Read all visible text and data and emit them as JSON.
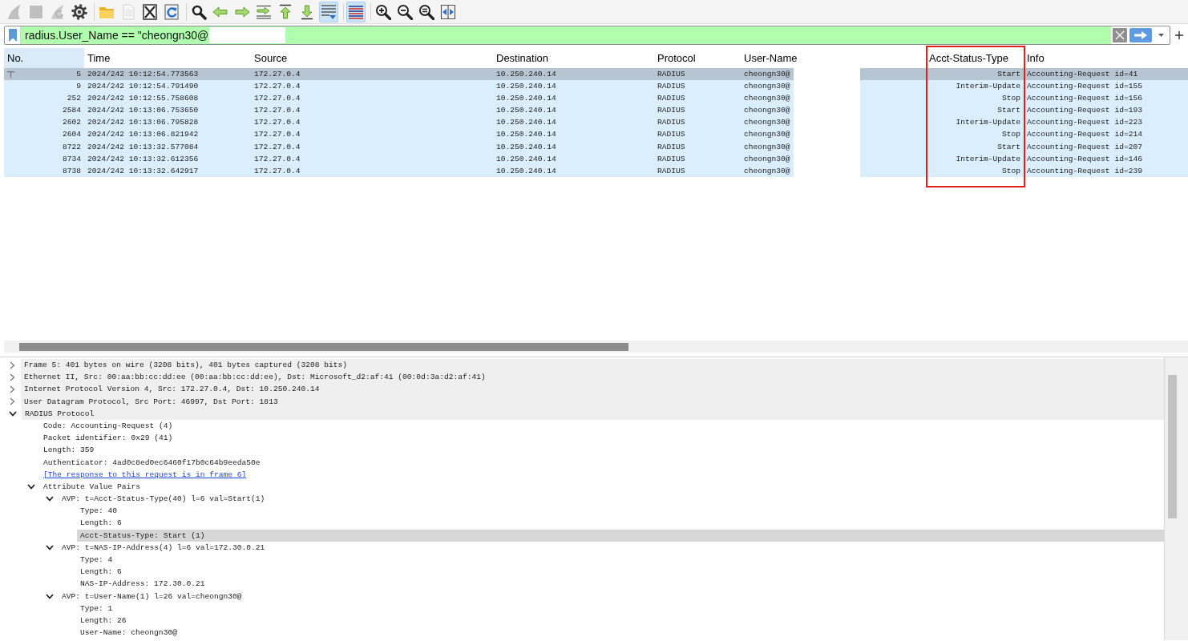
{
  "toolbar": {
    "groups": [
      [
        {
          "kind": "fin",
          "disabled": true,
          "pressed": false
        },
        {
          "kind": "stop",
          "disabled": true,
          "pressed": false
        },
        {
          "kind": "restart",
          "disabled": true,
          "pressed": false
        },
        {
          "kind": "options",
          "disabled": false,
          "pressed": false
        }
      ],
      [
        {
          "kind": "open",
          "disabled": false,
          "pressed": false
        },
        {
          "kind": "save",
          "disabled": true,
          "pressed": false
        },
        {
          "kind": "close",
          "disabled": false,
          "pressed": false
        },
        {
          "kind": "reload",
          "disabled": false,
          "pressed": false
        }
      ],
      [
        {
          "kind": "find",
          "disabled": false,
          "pressed": false
        },
        {
          "kind": "back",
          "disabled": false,
          "pressed": false
        },
        {
          "kind": "forward",
          "disabled": false,
          "pressed": false
        },
        {
          "kind": "goto",
          "disabled": false,
          "pressed": false
        },
        {
          "kind": "first",
          "disabled": false,
          "pressed": false
        },
        {
          "kind": "last",
          "disabled": false,
          "pressed": false
        },
        {
          "kind": "autoscroll",
          "disabled": false,
          "pressed": true
        }
      ],
      [
        {
          "kind": "colorize",
          "disabled": false,
          "pressed": true
        }
      ],
      [
        {
          "kind": "zoomin",
          "disabled": false,
          "pressed": false
        },
        {
          "kind": "zoomout",
          "disabled": false,
          "pressed": false
        },
        {
          "kind": "zoomreset",
          "disabled": false,
          "pressed": false
        },
        {
          "kind": "resize",
          "disabled": false,
          "pressed": false
        }
      ]
    ]
  },
  "filter": {
    "value": "radius.User_Name == \"cheongn30@",
    "valid": true,
    "redacted": true
  },
  "packet_list": {
    "columns": [
      {
        "title": "No.",
        "sorted": true,
        "highlighted": false,
        "redacted": false
      },
      {
        "title": "Time",
        "sorted": false,
        "highlighted": false,
        "redacted": false
      },
      {
        "title": "Source",
        "sorted": false,
        "highlighted": false,
        "redacted": false
      },
      {
        "title": "Destination",
        "sorted": false,
        "highlighted": false,
        "redacted": false
      },
      {
        "title": "Protocol",
        "sorted": false,
        "highlighted": false,
        "redacted": false
      },
      {
        "title": "User-Name",
        "sorted": false,
        "highlighted": false,
        "redacted": true
      },
      {
        "title": "Acct-Status-Type",
        "sorted": false,
        "highlighted": true,
        "redacted": false
      },
      {
        "title": "Info",
        "sorted": false,
        "highlighted": false,
        "redacted": false
      }
    ],
    "rows": [
      {
        "selected": true,
        "cells": [
          "5",
          "2024/242 10:12:54.773563",
          "172.27.0.4",
          "10.250.240.14",
          "RADIUS",
          "cheongn30@",
          "Start",
          "Accounting-Request id=41"
        ]
      },
      {
        "selected": false,
        "cells": [
          "9",
          "2024/242 10:12:54.791490",
          "172.27.0.4",
          "10.250.240.14",
          "RADIUS",
          "cheongn30@",
          "Interim-Update",
          "Accounting-Request id=155"
        ]
      },
      {
        "selected": false,
        "cells": [
          "252",
          "2024/242 10:12:55.758608",
          "172.27.0.4",
          "10.250.240.14",
          "RADIUS",
          "cheongn30@",
          "Stop",
          "Accounting-Request id=156"
        ]
      },
      {
        "selected": false,
        "cells": [
          "2584",
          "2024/242 10:13:06.753650",
          "172.27.0.4",
          "10.250.240.14",
          "RADIUS",
          "cheongn30@",
          "Start",
          "Accounting-Request id=193"
        ]
      },
      {
        "selected": false,
        "cells": [
          "2602",
          "2024/242 10:13:06.795828",
          "172.27.0.4",
          "10.250.240.14",
          "RADIUS",
          "cheongn30@",
          "Interim-Update",
          "Accounting-Request id=223"
        ]
      },
      {
        "selected": false,
        "cells": [
          "2604",
          "2024/242 10:13:06.821942",
          "172.27.0.4",
          "10.250.240.14",
          "RADIUS",
          "cheongn30@",
          "Stop",
          "Accounting-Request id=214"
        ]
      },
      {
        "selected": false,
        "cells": [
          "8722",
          "2024/242 10:13:32.577084",
          "172.27.0.4",
          "10.250.240.14",
          "RADIUS",
          "cheongn30@",
          "Start",
          "Accounting-Request id=207"
        ]
      },
      {
        "selected": false,
        "cells": [
          "8734",
          "2024/242 10:13:32.612356",
          "172.27.0.4",
          "10.250.240.14",
          "RADIUS",
          "cheongn30@",
          "Interim-Update",
          "Accounting-Request id=146"
        ]
      },
      {
        "selected": false,
        "cells": [
          "8738",
          "2024/242 10:13:32.642917",
          "172.27.0.4",
          "10.250.240.14",
          "RADIUS",
          "cheongn30@",
          "Stop",
          "Accounting-Request id=239"
        ]
      }
    ]
  },
  "details": {
    "tree": [
      {
        "label": "Frame 5: 401 bytes on wire (3208 bits), 401 bytes captured (3208 bits)",
        "kind": "protocol",
        "expanded": false,
        "selected": false
      },
      {
        "label": "Ethernet II, Src: 00:aa:bb:cc:dd:ee (00:aa:bb:cc:dd:ee), Dst: Microsoft_d2:af:41 (00:0d:3a:d2:af:41)",
        "kind": "protocol",
        "expanded": false,
        "selected": false
      },
      {
        "label": "Internet Protocol Version 4, Src: 172.27.0.4, Dst: 10.250.240.14",
        "kind": "protocol",
        "expanded": false,
        "selected": false
      },
      {
        "label": "User Datagram Protocol, Src Port: 46997, Dst Port: 1813",
        "kind": "protocol",
        "expanded": false,
        "selected": false
      },
      {
        "label": "RADIUS Protocol",
        "kind": "protocol",
        "expanded": true,
        "selected": false,
        "children": [
          {
            "label": "Code: Accounting-Request (4)",
            "kind": "field",
            "selected": false
          },
          {
            "label": "Packet identifier: 0x29 (41)",
            "kind": "field",
            "selected": false
          },
          {
            "label": "Length: 359",
            "kind": "field",
            "selected": false
          },
          {
            "label": "Authenticator: 4ad0c8ed0ec6460f17b0c64b9eeda50e",
            "kind": "field",
            "selected": false
          },
          {
            "label": "[The response to this request is in frame 6]",
            "kind": "link",
            "selected": false
          },
          {
            "label": "Attribute Value Pairs",
            "kind": "field",
            "expanded": true,
            "selected": false,
            "children": [
              {
                "label": "AVP: t=Acct-Status-Type(40) l=6 val=Start(1)",
                "kind": "field",
                "expanded": true,
                "selected": false,
                "children": [
                  {
                    "label": "Type: 40",
                    "kind": "field",
                    "selected": false
                  },
                  {
                    "label": "Length: 6",
                    "kind": "field",
                    "selected": false
                  },
                  {
                    "label": "Acct-Status-Type: Start (1)",
                    "kind": "field",
                    "selected": true
                  }
                ]
              },
              {
                "label": "AVP: t=NAS-IP-Address(4) l=6 val=172.30.0.21",
                "kind": "field",
                "expanded": true,
                "selected": false,
                "children": [
                  {
                    "label": "Type: 4",
                    "kind": "field",
                    "selected": false
                  },
                  {
                    "label": "Length: 6",
                    "kind": "field",
                    "selected": false
                  },
                  {
                    "label": "NAS-IP-Address: 172.30.0.21",
                    "kind": "field",
                    "selected": false
                  }
                ]
              },
              {
                "label": "AVP: t=User-Name(1) l=26 val=cheongn30@",
                "kind": "field",
                "expanded": true,
                "selected": false,
                "children": [
                  {
                    "label": "Type: 1",
                    "kind": "field",
                    "selected": false
                  },
                  {
                    "label": "Length: 26",
                    "kind": "field",
                    "selected": false
                  },
                  {
                    "label": "User-Name: cheongn30@",
                    "kind": "field",
                    "selected": false
                  }
                ]
              }
            ]
          }
        ]
      }
    ]
  }
}
